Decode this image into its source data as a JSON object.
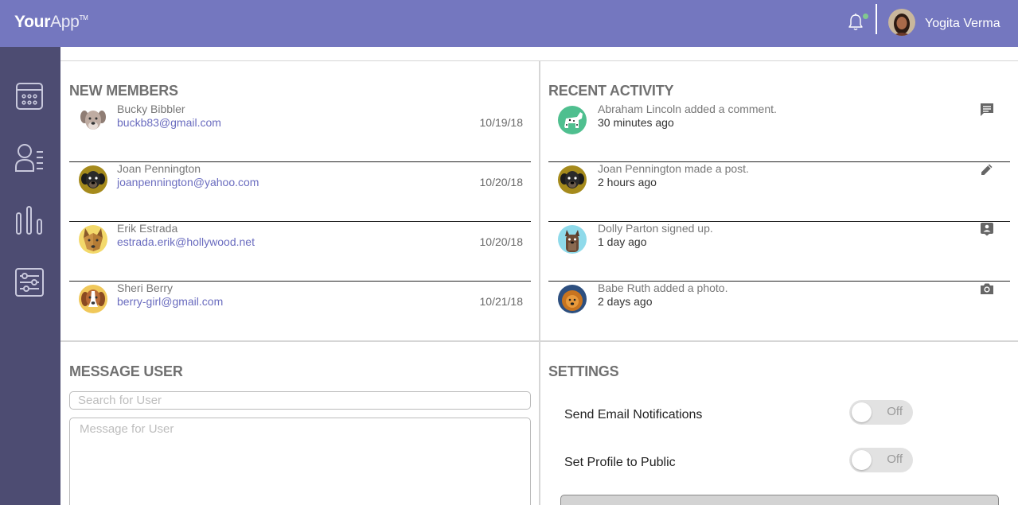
{
  "header": {
    "logo_bold": "Your",
    "logo_light": "App",
    "logo_tm": "TM",
    "user_name": "Yogita Verma",
    "notification_indicator": "online-green"
  },
  "sidebar": {
    "items": [
      {
        "icon": "calendar-icon"
      },
      {
        "icon": "members-icon"
      },
      {
        "icon": "stats-icon"
      },
      {
        "icon": "settings-sliders-icon"
      }
    ]
  },
  "new_members": {
    "title": "NEW MEMBERS",
    "rows": [
      {
        "name": "Bucky Bibbler",
        "email": "buckb83@gmail.com",
        "date": "10/19/18",
        "avatar": "dog-avatar-grey"
      },
      {
        "name": "Joan Pennington",
        "email": "joanpennington@yahoo.com",
        "date": "10/20/18",
        "avatar": "dog-avatar-black"
      },
      {
        "name": "Erik Estrada",
        "email": "estrada.erik@hollywood.net",
        "date": "10/20/18",
        "avatar": "dog-avatar-tan"
      },
      {
        "name": "Sheri Berry",
        "email": "berry-girl@gmail.com",
        "date": "10/21/18",
        "avatar": "dog-avatar-beagle"
      }
    ]
  },
  "recent_activity": {
    "title": "RECENT ACTIVITY",
    "rows": [
      {
        "text": "Abraham Lincoln added a comment.",
        "time": "30 minutes ago",
        "icon": "comment-icon",
        "avatar": "dalmatian-avatar"
      },
      {
        "text": "Joan Pennington made a post.",
        "time": "2 hours ago",
        "icon": "pencil-icon",
        "avatar": "dog-avatar-black"
      },
      {
        "text": "Dolly Parton signed up.",
        "time": "1 day ago",
        "icon": "contact-card-icon",
        "avatar": "yorkie-avatar"
      },
      {
        "text": "Babe Ruth added a photo.",
        "time": "2 days ago",
        "icon": "camera-icon",
        "avatar": "chow-avatar"
      }
    ]
  },
  "message_user": {
    "title": "MESSAGE USER",
    "search_placeholder": "Search for User",
    "message_placeholder": "Message for User"
  },
  "settings": {
    "title": "SETTINGS",
    "items": [
      {
        "label": "Send Email Notifications",
        "state": "Off"
      },
      {
        "label": "Set Profile to Public",
        "state": "Off"
      }
    ]
  },
  "colors": {
    "header": "#7477bf",
    "sidebar": "#4d4c72",
    "link": "#6a6cbf",
    "indicator": "#81c98f"
  }
}
